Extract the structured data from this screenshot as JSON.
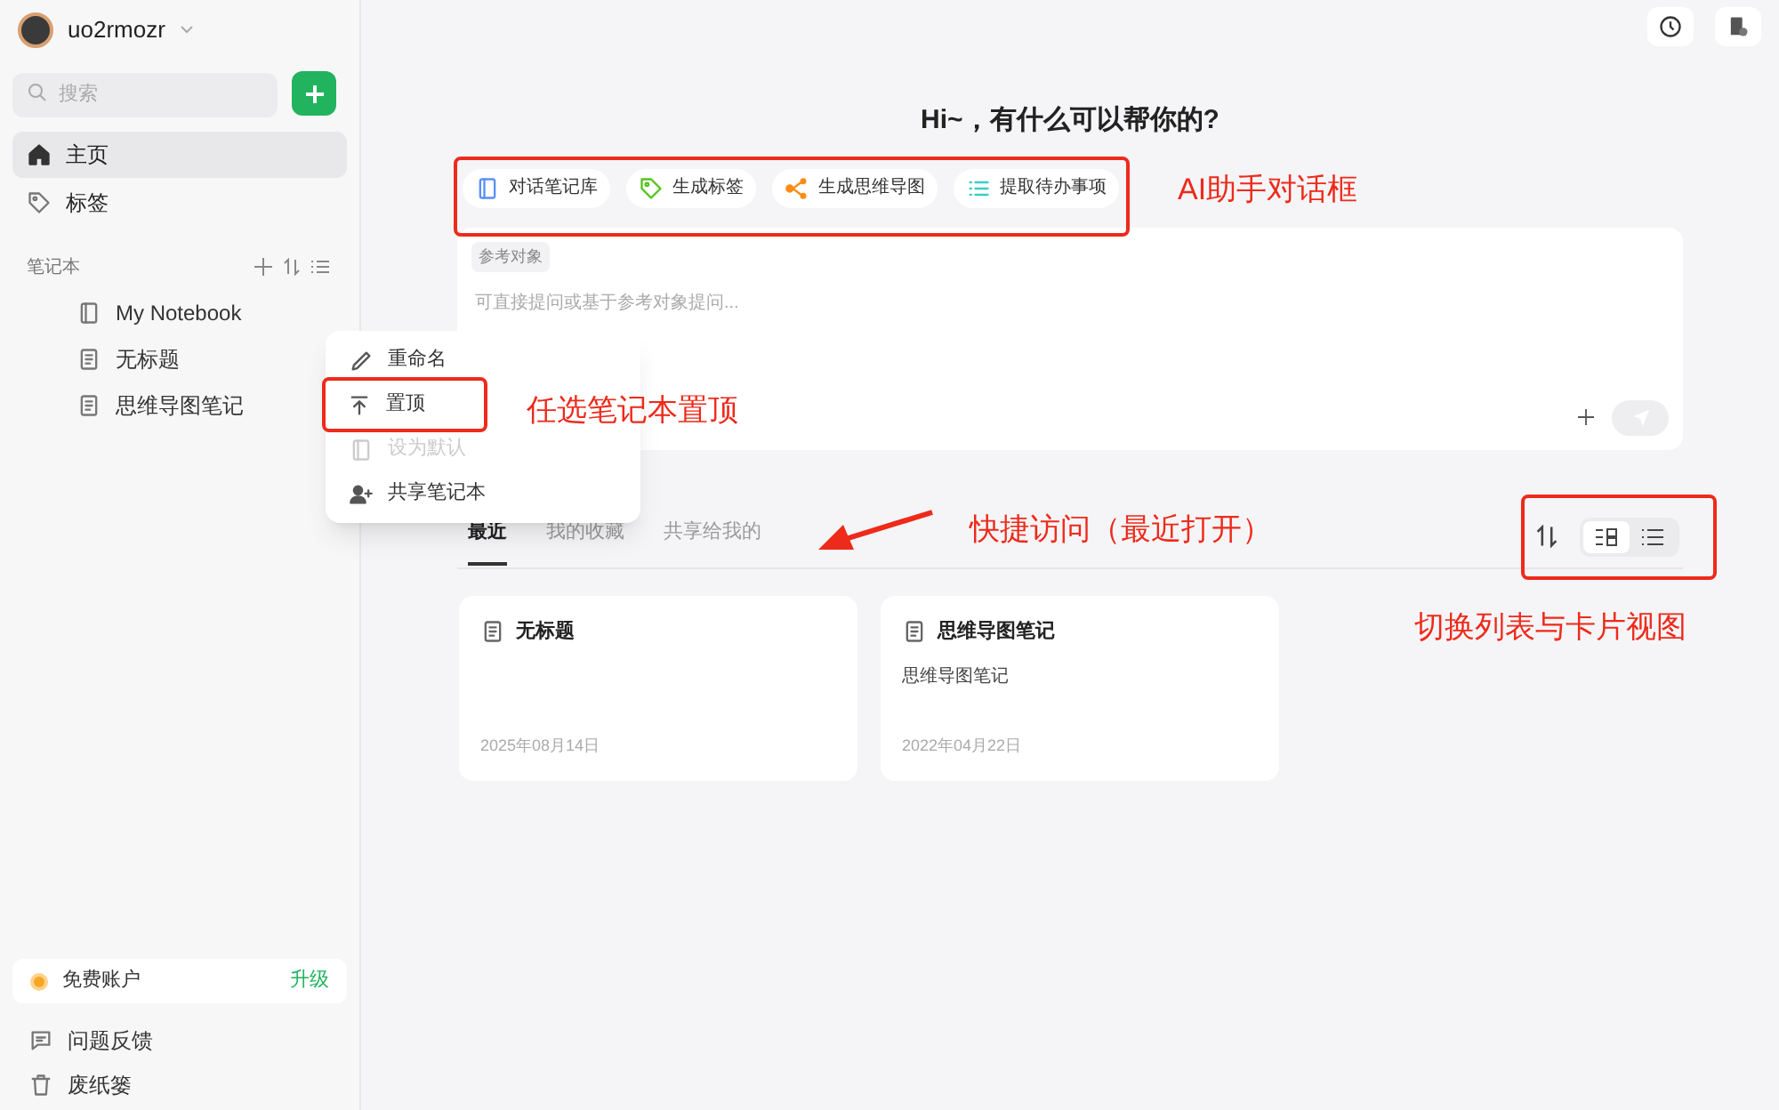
{
  "sidebar": {
    "username": "uo2rmozr",
    "search": {
      "placeholder": "搜索"
    },
    "nav": [
      {
        "label": "主页",
        "selected": true
      },
      {
        "label": "标签",
        "selected": false
      }
    ],
    "notebooks_title": "笔记本",
    "tree": [
      {
        "label": "My Notebook",
        "kind": "notebook",
        "children": [
          {
            "label": "无标题",
            "kind": "note"
          },
          {
            "label": "思维导图笔记",
            "kind": "note"
          }
        ]
      }
    ],
    "account": {
      "label": "免费账户",
      "action": "升级"
    },
    "footer": [
      {
        "label": "问题反馈"
      },
      {
        "label": "废纸篓"
      }
    ]
  },
  "context_menu": [
    {
      "label": "重命名",
      "disabled": false,
      "highlighted": false
    },
    {
      "label": "置顶",
      "disabled": false,
      "highlighted": true
    },
    {
      "label": "设为默认",
      "disabled": true,
      "highlighted": false
    },
    {
      "label": "共享笔记本",
      "disabled": false,
      "highlighted": false
    }
  ],
  "greeting": "Hi~，有什么可以帮你的?",
  "chips": [
    {
      "label": "对话笔记库"
    },
    {
      "label": "生成标签"
    },
    {
      "label": "生成思维导图"
    },
    {
      "label": "提取待办事项"
    }
  ],
  "chat": {
    "reference": "参考对象",
    "placeholder": "可直接提问或基于参考对象提问..."
  },
  "tabs": [
    {
      "label": "最近",
      "selected": true
    },
    {
      "label": "我的收藏",
      "selected": false
    },
    {
      "label": "共享给我的",
      "selected": false
    }
  ],
  "view_toggle": [
    {
      "kind": "card",
      "selected": true
    },
    {
      "kind": "list",
      "selected": false
    }
  ],
  "cards": [
    {
      "title": "无标题",
      "date": "2025年08月14日"
    },
    {
      "title": "思维导图笔记",
      "body": "思维导图笔记",
      "date": "2022年04月22日"
    }
  ],
  "annotations": [
    "AI助手对话框",
    "任选笔记本置顶",
    "快捷访问（最近打开）",
    "切换列表与卡片视图"
  ]
}
